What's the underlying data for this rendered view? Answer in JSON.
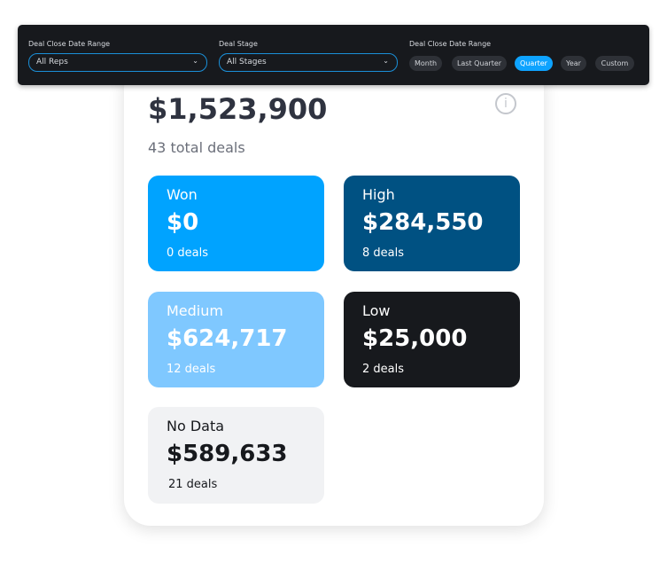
{
  "toolbar": {
    "reps_label": "Deal Close Date Range",
    "reps_value": "All Reps",
    "stage_label": "Deal Stage",
    "stage_value": "All Stages",
    "range_label": "Deal Close Date Range",
    "ranges": [
      "Month",
      "Last Quarter",
      "Quarter",
      "Year",
      "Custom"
    ],
    "active_range": "Quarter"
  },
  "summary": {
    "total": "$1,523,900",
    "count": "43 total deals",
    "info_icon": "info-icon"
  },
  "tiles": [
    {
      "name": "Won",
      "value": "$0",
      "deals": "0 deals",
      "color": "#00a3ff"
    },
    {
      "name": "High",
      "value": "$284,550",
      "deals": "8 deals",
      "color": "#005182"
    },
    {
      "name": "Medium",
      "value": "$624,717",
      "deals": "12 deals",
      "color": "#7fc8ff"
    },
    {
      "name": "Low",
      "value": "$25,000",
      "deals": "2 deals",
      "color": "#17191d"
    },
    {
      "name": "No Data",
      "value": "$589,633",
      "deals": "21 deals",
      "color": "#f1f2f4"
    }
  ]
}
